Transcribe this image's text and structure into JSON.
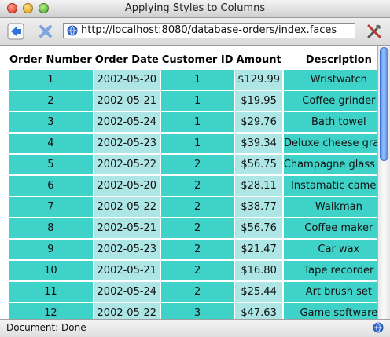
{
  "window": {
    "title": "Applying Styles to Columns"
  },
  "toolbar": {
    "url": "http://localhost:8080/database-orders/index.faces"
  },
  "table": {
    "headers": [
      "Order Number",
      "Order Date",
      "Customer ID",
      "Amount",
      "Description"
    ],
    "rows": [
      [
        "1",
        "2002-05-20",
        "1",
        "$129.99",
        "Wristwatch"
      ],
      [
        "2",
        "2002-05-21",
        "1",
        "$19.95",
        "Coffee grinder"
      ],
      [
        "3",
        "2002-05-24",
        "1",
        "$29.76",
        "Bath towel"
      ],
      [
        "4",
        "2002-05-23",
        "1",
        "$39.34",
        "Deluxe cheese grater"
      ],
      [
        "5",
        "2002-05-22",
        "2",
        "$56.75",
        "Champagne glass set"
      ],
      [
        "6",
        "2002-05-20",
        "2",
        "$28.11",
        "Instamatic camera"
      ],
      [
        "7",
        "2002-05-22",
        "2",
        "$38.77",
        "Walkman"
      ],
      [
        "8",
        "2002-05-21",
        "2",
        "$56.76",
        "Coffee maker"
      ],
      [
        "9",
        "2002-05-23",
        "2",
        "$21.47",
        "Car wax"
      ],
      [
        "10",
        "2002-05-21",
        "2",
        "$16.80",
        "Tape recorder"
      ],
      [
        "11",
        "2002-05-24",
        "2",
        "$25.44",
        "Art brush set"
      ],
      [
        "12",
        "2002-05-22",
        "3",
        "$47.63",
        "Game software"
      ]
    ]
  },
  "status": {
    "text": "Document: Done"
  },
  "colors": {
    "column_dark": "#3fd2c8",
    "column_light": "#aee6e6"
  }
}
